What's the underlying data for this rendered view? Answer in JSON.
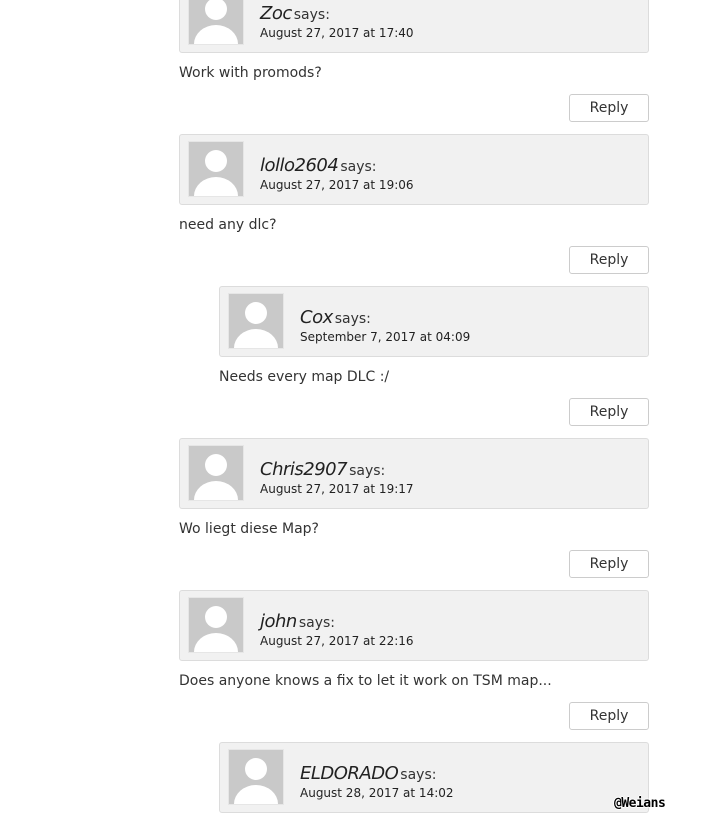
{
  "comments": [
    {
      "author": "Zoc",
      "says": "says:",
      "date": "August 27, 2017 at 17:40",
      "text": "Work with promods?",
      "reply": "Reply"
    },
    {
      "author": "lollo2604",
      "says": "says:",
      "date": "August 27, 2017 at 19:06",
      "text": "need any dlc?",
      "reply": "Reply"
    },
    {
      "author": "Cox",
      "says": "says:",
      "date": "September 7, 2017 at 04:09",
      "text": "Needs every map DLC :/",
      "reply": "Reply"
    },
    {
      "author": "Chris2907",
      "says": "says:",
      "date": "August 27, 2017 at 19:17",
      "text": "Wo liegt diese Map?",
      "reply": "Reply"
    },
    {
      "author": "john",
      "says": "says:",
      "date": "August 27, 2017 at 22:16",
      "text": "Does anyone knows a fix to let it work on TSM map...",
      "reply": "Reply"
    },
    {
      "author": "ELDORADO",
      "says": "says:",
      "date": "August 28, 2017 at 14:02"
    }
  ],
  "watermark": "@Weians",
  "colors": {
    "meta_bg": "#f1f1f1",
    "meta_border": "#dcdcdc",
    "avatar_bg": "#c9c9c9",
    "avatar_fg": "#ffffff"
  }
}
